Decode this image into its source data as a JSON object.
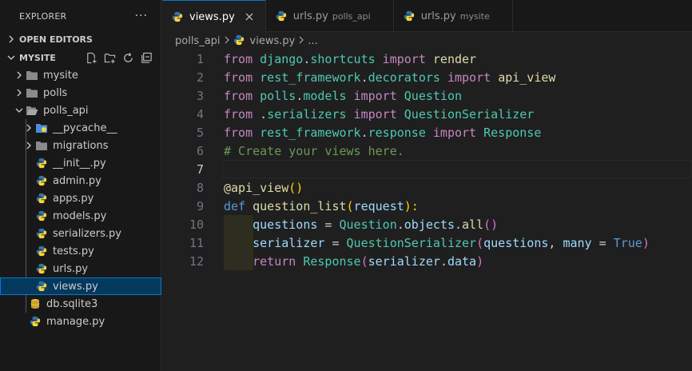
{
  "explorer": {
    "title": "EXPLORER",
    "more": "···",
    "open_editors": "OPEN EDITORS",
    "project": "MYSITE",
    "tree": [
      {
        "label": "mysite",
        "kind": "folder"
      },
      {
        "label": "polls",
        "kind": "folder"
      },
      {
        "label": "polls_api",
        "kind": "folder-open"
      },
      {
        "label": "__pycache__",
        "kind": "pycache"
      },
      {
        "label": "migrations",
        "kind": "folder"
      },
      {
        "label": "__init__.py",
        "kind": "python"
      },
      {
        "label": "admin.py",
        "kind": "python"
      },
      {
        "label": "apps.py",
        "kind": "python"
      },
      {
        "label": "models.py",
        "kind": "python"
      },
      {
        "label": "serializers.py",
        "kind": "python"
      },
      {
        "label": "tests.py",
        "kind": "python"
      },
      {
        "label": "urls.py",
        "kind": "python"
      },
      {
        "label": "views.py",
        "kind": "python",
        "selected": true
      },
      {
        "label": "db.sqlite3",
        "kind": "database"
      },
      {
        "label": "manage.py",
        "kind": "python"
      }
    ]
  },
  "tabs": [
    {
      "label": "views.py",
      "desc": "",
      "active": true
    },
    {
      "label": "urls.py",
      "desc": "polls_api",
      "active": false
    },
    {
      "label": "urls.py",
      "desc": "mysite",
      "active": false
    }
  ],
  "breadcrumb": {
    "folder": "polls_api",
    "file": "views.py",
    "more": "..."
  },
  "editor": {
    "current_line": 7,
    "line_numbers": [
      "1",
      "2",
      "3",
      "4",
      "5",
      "6",
      "7",
      "8",
      "9",
      "10",
      "11",
      "12"
    ],
    "lines": [
      [
        [
          "from",
          "kw2"
        ],
        [
          " django",
          "mod"
        ],
        [
          ".",
          "plain"
        ],
        [
          "shortcuts",
          "mod"
        ],
        [
          " import ",
          "kw2"
        ],
        [
          "render",
          "fn"
        ]
      ],
      [
        [
          "from",
          "kw2"
        ],
        [
          " rest_framework",
          "mod"
        ],
        [
          ".",
          "plain"
        ],
        [
          "decorators",
          "mod"
        ],
        [
          " import ",
          "kw2"
        ],
        [
          "api_view",
          "fn"
        ]
      ],
      [
        [
          "from",
          "kw2"
        ],
        [
          " polls",
          "mod"
        ],
        [
          ".",
          "plain"
        ],
        [
          "models",
          "mod"
        ],
        [
          " import ",
          "kw2"
        ],
        [
          "Question",
          "mod"
        ]
      ],
      [
        [
          "from",
          "kw2"
        ],
        [
          " .",
          "plain"
        ],
        [
          "serializers",
          "mod"
        ],
        [
          " import ",
          "kw2"
        ],
        [
          "QuestionSerializer",
          "mod"
        ]
      ],
      [
        [
          "from",
          "kw2"
        ],
        [
          " rest_framework",
          "mod"
        ],
        [
          ".",
          "plain"
        ],
        [
          "response",
          "mod"
        ],
        [
          " import ",
          "kw2"
        ],
        [
          "Response",
          "mod"
        ]
      ],
      [
        [
          "# Create your views here.",
          "cmt"
        ]
      ],
      [],
      [
        [
          "@api_view",
          "dec"
        ],
        [
          "()",
          "br1"
        ]
      ],
      [
        [
          "def",
          "kw"
        ],
        [
          " question_list",
          "fn"
        ],
        [
          "(",
          "br1"
        ],
        [
          "request",
          "var"
        ],
        [
          "):",
          "br1"
        ]
      ],
      [
        [
          "    ",
          "plain"
        ],
        [
          "questions",
          "var"
        ],
        [
          " = ",
          "plain"
        ],
        [
          "Question",
          "mod"
        ],
        [
          ".",
          "plain"
        ],
        [
          "objects",
          "var"
        ],
        [
          ".",
          "plain"
        ],
        [
          "all",
          "fn"
        ],
        [
          "()",
          "br2"
        ]
      ],
      [
        [
          "    ",
          "plain"
        ],
        [
          "serializer",
          "var"
        ],
        [
          " = ",
          "plain"
        ],
        [
          "QuestionSerializer",
          "mod"
        ],
        [
          "(",
          "br2"
        ],
        [
          "questions",
          "var"
        ],
        [
          ", ",
          "plain"
        ],
        [
          "many",
          "var"
        ],
        [
          " = ",
          "plain"
        ],
        [
          "True",
          "kw"
        ],
        [
          ")",
          "br2"
        ]
      ],
      [
        [
          "    ",
          "plain"
        ],
        [
          "return",
          "kw2"
        ],
        [
          " Response",
          "mod"
        ],
        [
          "(",
          "br2"
        ],
        [
          "serializer",
          "var"
        ],
        [
          ".",
          "plain"
        ],
        [
          "data",
          "var"
        ],
        [
          ")",
          "br2"
        ]
      ]
    ]
  },
  "colors": {
    "accent": "#0078d4",
    "selection": "#04395e",
    "python_blue": "#3572a5",
    "python_yellow": "#ffd43b"
  }
}
